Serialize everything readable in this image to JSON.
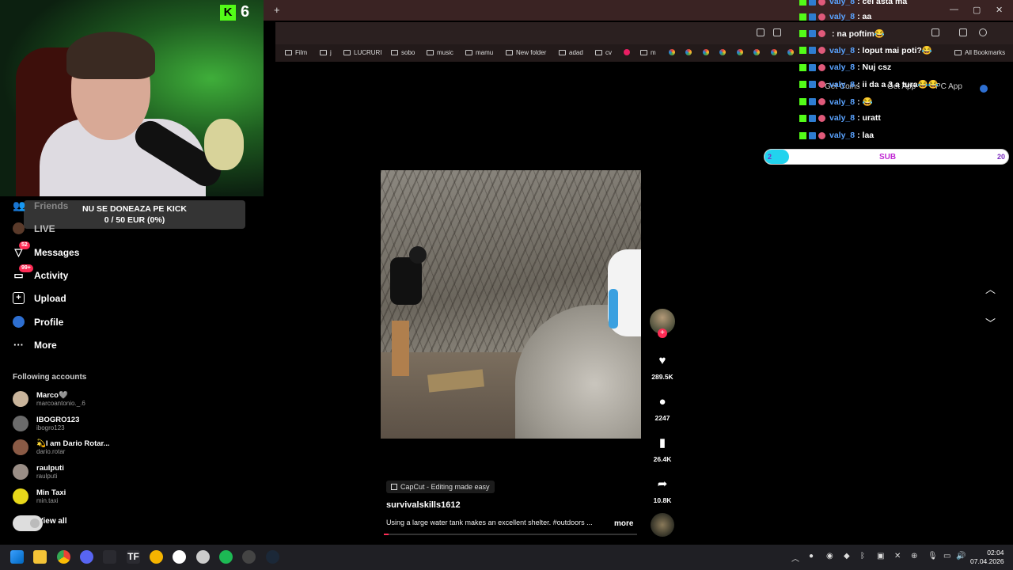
{
  "browser": {
    "new_tab": "+",
    "window_controls": [
      "—",
      "▢",
      "✕"
    ],
    "bookmarks": [
      "Film",
      "j",
      "LUCRURI",
      "sobo",
      "music",
      "mamu",
      "New folder",
      "adad",
      "cv",
      "m"
    ],
    "all_bookmarks": "All Bookmarks"
  },
  "webcam": {
    "kick_count": "6"
  },
  "donation": {
    "title": "NU SE DONEAZA PE KICK",
    "progress_text": "0 / 50 EUR (0%)"
  },
  "sidebar": {
    "friends": "Friends",
    "live": "LIVE",
    "messages": "Messages",
    "messages_badge": "52",
    "activity": "Activity",
    "activity_badge": "99+",
    "upload": "Upload",
    "profile": "Profile",
    "more": "More",
    "following_title": "Following accounts",
    "accounts": [
      {
        "name": "Marco🩶",
        "handle": "marcoantonio._.6"
      },
      {
        "name": "IBOGRO123",
        "handle": "ibogro123"
      },
      {
        "name": "💫I am Dario Rotar...",
        "handle": "dario.rotar"
      },
      {
        "name": "raulputi",
        "handle": "raulputi"
      },
      {
        "name": "Min Taxi",
        "handle": "min.taxi"
      }
    ],
    "view_all": "View all"
  },
  "video": {
    "capcut_label": "CapCut - Editing made easy",
    "author": "survivalskills1612",
    "description": "Using a large water tank makes an excellent shelter. #outdoors ...",
    "more": "more",
    "likes": "289.5K",
    "comments": "2247",
    "saves": "26.4K",
    "shares": "10.8K",
    "progress": 0.02
  },
  "appbar": {
    "get_coins": "Get Coins",
    "get_app": "Get App",
    "pc_app": "PC App"
  },
  "chat": [
    {
      "user": "valy_8",
      "msg": ": cel asta ma"
    },
    {
      "user": "valy_8",
      "msg": ": aa"
    },
    {
      "user": "",
      "msg": ": na poftim😂"
    },
    {
      "user": "valy_8",
      "msg": ": loput mai poti?😂"
    },
    {
      "user": "valy_8",
      "msg": ": Nuj csz"
    },
    {
      "user": "valy_8",
      "msg": ": ii da a 3 a tura😂😂"
    },
    {
      "user": "valy_8",
      "msg": ": 😂"
    },
    {
      "user": "valy_8",
      "msg": ": uratt"
    },
    {
      "user": "valy_8",
      "msg": ": laa"
    }
  ],
  "sub_goal": {
    "current": "2",
    "label": "SUB",
    "goal": "20",
    "fraction": 0.1
  },
  "taskbar": {
    "time": "02:04",
    "date": "07.04.2026"
  },
  "colors": {
    "kick_green": "#53fc18",
    "tiktok_red": "#fe2c55",
    "chat_user_blue": "#5aa3ff",
    "sub_fill": "#22d3ee"
  }
}
